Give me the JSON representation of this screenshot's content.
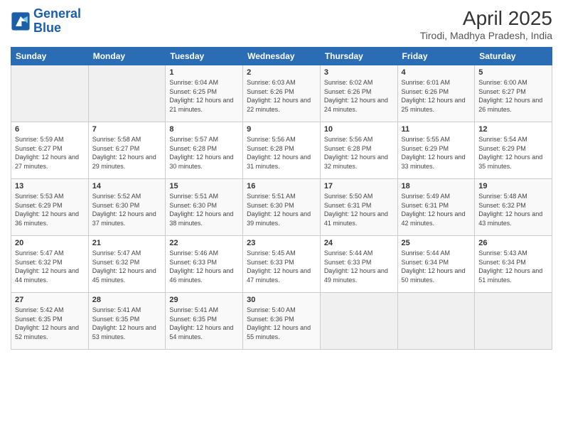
{
  "header": {
    "logo_line1": "General",
    "logo_line2": "Blue",
    "title": "April 2025",
    "subtitle": "Tirodi, Madhya Pradesh, India"
  },
  "days_of_week": [
    "Sunday",
    "Monday",
    "Tuesday",
    "Wednesday",
    "Thursday",
    "Friday",
    "Saturday"
  ],
  "weeks": [
    {
      "days": [
        {
          "num": "",
          "empty": true
        },
        {
          "num": "",
          "empty": true
        },
        {
          "num": "1",
          "sunrise": "6:04 AM",
          "sunset": "6:25 PM",
          "daylight": "12 hours and 21 minutes."
        },
        {
          "num": "2",
          "sunrise": "6:03 AM",
          "sunset": "6:26 PM",
          "daylight": "12 hours and 22 minutes."
        },
        {
          "num": "3",
          "sunrise": "6:02 AM",
          "sunset": "6:26 PM",
          "daylight": "12 hours and 24 minutes."
        },
        {
          "num": "4",
          "sunrise": "6:01 AM",
          "sunset": "6:26 PM",
          "daylight": "12 hours and 25 minutes."
        },
        {
          "num": "5",
          "sunrise": "6:00 AM",
          "sunset": "6:27 PM",
          "daylight": "12 hours and 26 minutes."
        }
      ]
    },
    {
      "days": [
        {
          "num": "6",
          "sunrise": "5:59 AM",
          "sunset": "6:27 PM",
          "daylight": "12 hours and 27 minutes."
        },
        {
          "num": "7",
          "sunrise": "5:58 AM",
          "sunset": "6:27 PM",
          "daylight": "12 hours and 29 minutes."
        },
        {
          "num": "8",
          "sunrise": "5:57 AM",
          "sunset": "6:28 PM",
          "daylight": "12 hours and 30 minutes."
        },
        {
          "num": "9",
          "sunrise": "5:56 AM",
          "sunset": "6:28 PM",
          "daylight": "12 hours and 31 minutes."
        },
        {
          "num": "10",
          "sunrise": "5:56 AM",
          "sunset": "6:28 PM",
          "daylight": "12 hours and 32 minutes."
        },
        {
          "num": "11",
          "sunrise": "5:55 AM",
          "sunset": "6:29 PM",
          "daylight": "12 hours and 33 minutes."
        },
        {
          "num": "12",
          "sunrise": "5:54 AM",
          "sunset": "6:29 PM",
          "daylight": "12 hours and 35 minutes."
        }
      ]
    },
    {
      "days": [
        {
          "num": "13",
          "sunrise": "5:53 AM",
          "sunset": "6:29 PM",
          "daylight": "12 hours and 36 minutes."
        },
        {
          "num": "14",
          "sunrise": "5:52 AM",
          "sunset": "6:30 PM",
          "daylight": "12 hours and 37 minutes."
        },
        {
          "num": "15",
          "sunrise": "5:51 AM",
          "sunset": "6:30 PM",
          "daylight": "12 hours and 38 minutes."
        },
        {
          "num": "16",
          "sunrise": "5:51 AM",
          "sunset": "6:30 PM",
          "daylight": "12 hours and 39 minutes."
        },
        {
          "num": "17",
          "sunrise": "5:50 AM",
          "sunset": "6:31 PM",
          "daylight": "12 hours and 41 minutes."
        },
        {
          "num": "18",
          "sunrise": "5:49 AM",
          "sunset": "6:31 PM",
          "daylight": "12 hours and 42 minutes."
        },
        {
          "num": "19",
          "sunrise": "5:48 AM",
          "sunset": "6:32 PM",
          "daylight": "12 hours and 43 minutes."
        }
      ]
    },
    {
      "days": [
        {
          "num": "20",
          "sunrise": "5:47 AM",
          "sunset": "6:32 PM",
          "daylight": "12 hours and 44 minutes."
        },
        {
          "num": "21",
          "sunrise": "5:47 AM",
          "sunset": "6:32 PM",
          "daylight": "12 hours and 45 minutes."
        },
        {
          "num": "22",
          "sunrise": "5:46 AM",
          "sunset": "6:33 PM",
          "daylight": "12 hours and 46 minutes."
        },
        {
          "num": "23",
          "sunrise": "5:45 AM",
          "sunset": "6:33 PM",
          "daylight": "12 hours and 47 minutes."
        },
        {
          "num": "24",
          "sunrise": "5:44 AM",
          "sunset": "6:33 PM",
          "daylight": "12 hours and 49 minutes."
        },
        {
          "num": "25",
          "sunrise": "5:44 AM",
          "sunset": "6:34 PM",
          "daylight": "12 hours and 50 minutes."
        },
        {
          "num": "26",
          "sunrise": "5:43 AM",
          "sunset": "6:34 PM",
          "daylight": "12 hours and 51 minutes."
        }
      ]
    },
    {
      "days": [
        {
          "num": "27",
          "sunrise": "5:42 AM",
          "sunset": "6:35 PM",
          "daylight": "12 hours and 52 minutes."
        },
        {
          "num": "28",
          "sunrise": "5:41 AM",
          "sunset": "6:35 PM",
          "daylight": "12 hours and 53 minutes."
        },
        {
          "num": "29",
          "sunrise": "5:41 AM",
          "sunset": "6:35 PM",
          "daylight": "12 hours and 54 minutes."
        },
        {
          "num": "30",
          "sunrise": "5:40 AM",
          "sunset": "6:36 PM",
          "daylight": "12 hours and 55 minutes."
        },
        {
          "num": "",
          "empty": true
        },
        {
          "num": "",
          "empty": true
        },
        {
          "num": "",
          "empty": true
        }
      ]
    }
  ]
}
